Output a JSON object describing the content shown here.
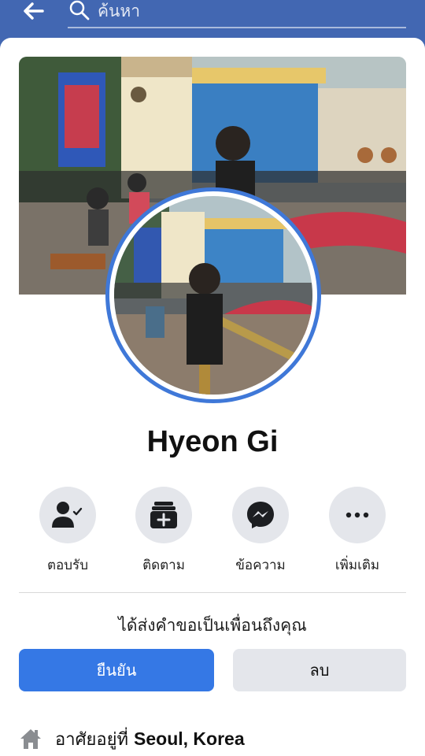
{
  "search": {
    "placeholder": "ค้นหา"
  },
  "profile": {
    "name": "Hyeon Gi"
  },
  "actions": [
    {
      "label": "ตอบรับ",
      "icon": "person-check-icon"
    },
    {
      "label": "ติดตาม",
      "icon": "follow-add-icon"
    },
    {
      "label": "ข้อความ",
      "icon": "messenger-icon"
    },
    {
      "label": "เพิ่มเติม",
      "icon": "more-dots-icon"
    }
  ],
  "friend_request": {
    "text": "ได้ส่งคำขอเป็นเพื่อนถึงคุณ",
    "confirm_label": "ยืนยัน",
    "delete_label": "ลบ"
  },
  "about": {
    "lives_prefix": "อาศัยอยู่ที่",
    "lives_place": "Seoul, Korea"
  },
  "colors": {
    "header": "#4267b2",
    "accent": "#3578e5",
    "ring": "#3f78d8",
    "button_gray": "#e4e6eb"
  }
}
